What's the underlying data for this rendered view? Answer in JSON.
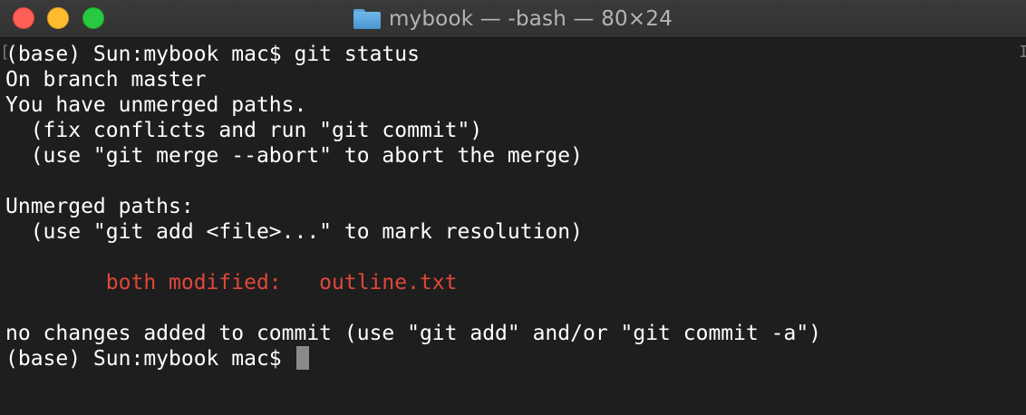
{
  "window": {
    "title": "mybook — -bash — 80×24",
    "folder_icon": "folder-icon"
  },
  "terminal": {
    "lines": [
      "(base) Sun:mybook mac$ git status",
      "On branch master",
      "You have unmerged paths.",
      "  (fix conflicts and run \"git commit\")",
      "  (use \"git merge --abort\" to abort the merge)",
      "",
      "Unmerged paths:",
      "  (use \"git add <file>...\" to mark resolution)",
      "",
      "        both modified:   outline.txt",
      "",
      "no changes added to commit (use \"git add\" and/or \"git commit -a\")"
    ],
    "prompt": "(base) Sun:mybook mac$ ",
    "conflict_color": "#e0473a",
    "text_color": "#ffffff",
    "background": "#1e1e1e"
  }
}
